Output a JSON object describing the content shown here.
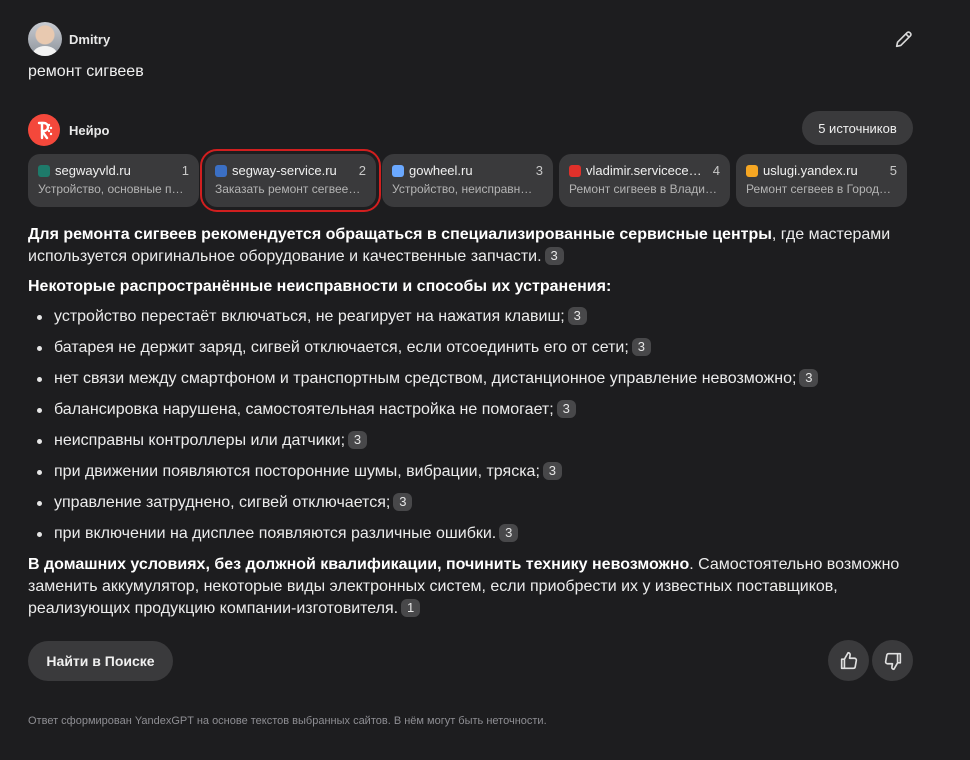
{
  "user": {
    "name": "Dmitry"
  },
  "query": "ремонт сигвеев",
  "neuro": {
    "name": "Нейро",
    "sources_label": "5 источников"
  },
  "sources": [
    {
      "domain": "segwayvld.ru",
      "num": "1",
      "desc": "Устройство, основные п…",
      "favicon_color": "#1e7a6a"
    },
    {
      "domain": "segway-service.ru",
      "num": "2",
      "desc": "Заказать ремонт сегвее…",
      "favicon_color": "#3b6fc4"
    },
    {
      "domain": "gowheel.ru",
      "num": "3",
      "desc": "Устройство, неисправн…",
      "favicon_color": "#6aa8ff"
    },
    {
      "domain": "vladimir.servicecent…",
      "num": "4",
      "desc": "Ремонт сигвеев в Влади…",
      "favicon_color": "#e0302a"
    },
    {
      "domain": "uslugi.yandex.ru",
      "num": "5",
      "desc": "Ремонт сегвеев в Город…",
      "favicon_color": "#f5a623"
    }
  ],
  "answer": {
    "intro_bold": "Для ремонта сигвеев рекомендуется обращаться в специализированные сервисные центры",
    "intro_rest": ", где мастерами используется оригинальное оборудование и качественные запчасти.",
    "intro_ref": "3",
    "list_heading": "Некоторые распространённые неисправности и способы их устранения:",
    "items": [
      {
        "text": "устройство перестаёт включаться, не реагирует на нажатия клавиш;",
        "ref": "3"
      },
      {
        "text": "батарея не держит заряд, сигвей отключается, если отсоединить его от сети;",
        "ref": "3"
      },
      {
        "text": "нет связи между смартфоном и транспортным средством, дистанционное управление невозможно;",
        "ref": "3"
      },
      {
        "text": "балансировка нарушена, самостоятельная настройка не помогает;",
        "ref": "3"
      },
      {
        "text": "неисправны контроллеры или датчики;",
        "ref": "3"
      },
      {
        "text": "при движении появляются посторонние шумы, вибрации, тряска;",
        "ref": "3"
      },
      {
        "text": "управление затруднено, сигвей отключается;",
        "ref": "3"
      },
      {
        "text": "при включении на дисплее появляются различные ошибки.",
        "ref": "3"
      }
    ],
    "outro_bold": "В домашних условиях, без должной квалификации, починить технику невозможно",
    "outro_rest": ". Самостоятельно возможно заменить аккумулятор, некоторые виды электронных систем, если приобрести их у известных поставщиков, реализующих продукцию компании-изготовителя.",
    "outro_ref": "1"
  },
  "actions": {
    "find_label": "Найти в Поиске"
  },
  "footer": "Ответ сформирован YandexGPT на основе текстов выбранных сайтов. В нём могут быть неточности."
}
